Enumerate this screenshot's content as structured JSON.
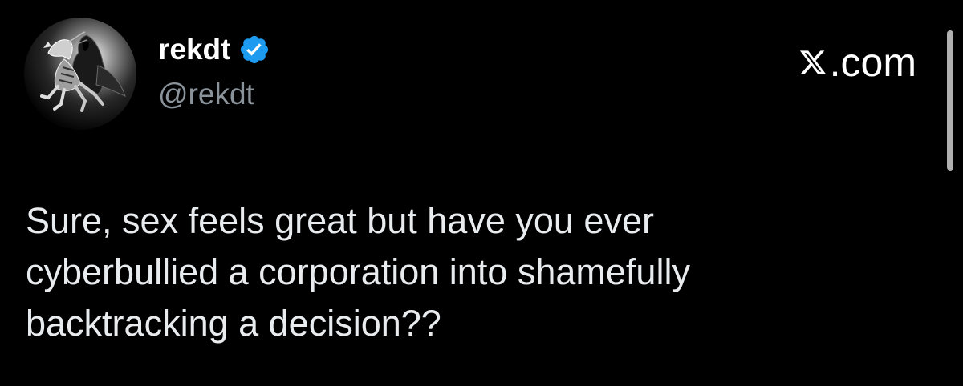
{
  "author": {
    "display_name": "rekdt",
    "handle": "@rekdt",
    "verified": true,
    "verified_color": "#1d9bf0",
    "avatar_icon": "skeletal-horse-rider-avatar"
  },
  "site": {
    "label": ".com",
    "logo_icon": "x-logo-icon"
  },
  "tweet": {
    "lines": [
      "Sure, sex feels great but have you ever",
      "cyberbullied a corporation into shamefully",
      "backtracking a decision??"
    ]
  },
  "colors": {
    "background": "#000000",
    "text": "#e9ecef",
    "secondary_text": "#8b939a"
  }
}
